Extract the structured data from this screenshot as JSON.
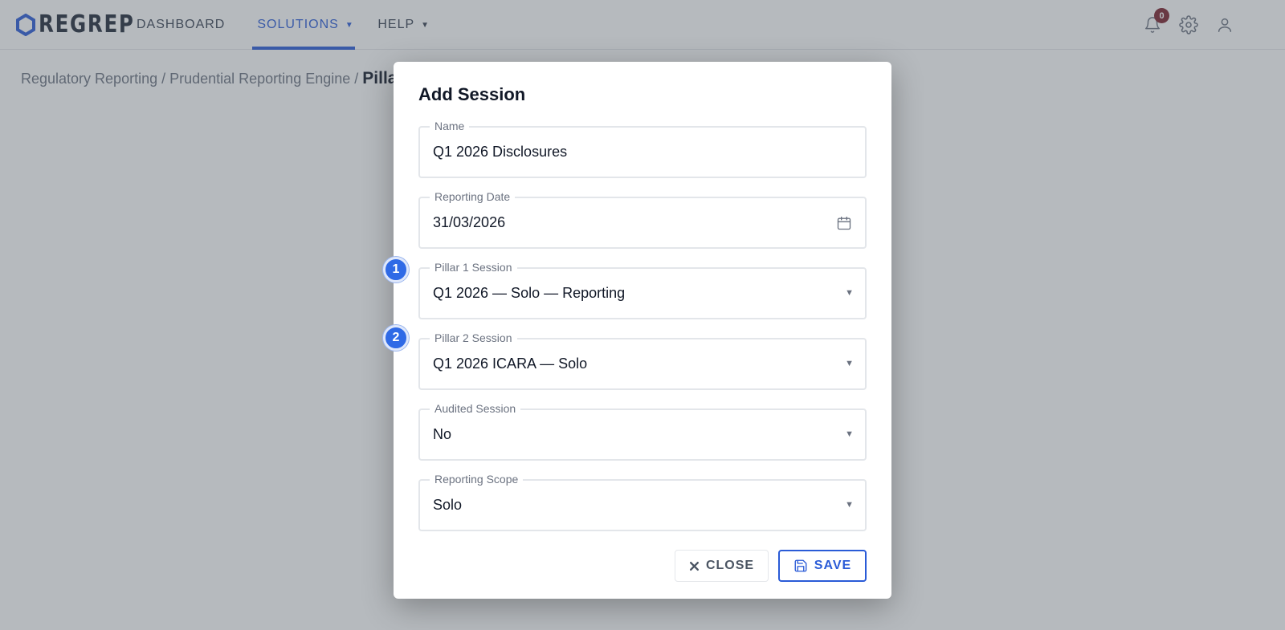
{
  "app": {
    "logo_text": "REGREP",
    "brand_color": "#2a5bd7",
    "nav": [
      {
        "label": "DASHBOARD"
      },
      {
        "label": "SOLUTIONS",
        "active": true
      },
      {
        "label": "HELP"
      }
    ],
    "notifications_count": "0"
  },
  "breadcrumb": {
    "path": "Regulatory Reporting / Prudential Reporting Engine /",
    "current": "Pillar"
  },
  "modal": {
    "title": "Add Session",
    "fields": [
      {
        "label": "Name",
        "value": "Q1 2026 Disclosures",
        "type": "text"
      },
      {
        "label": "Reporting Date",
        "value": "31/03/2026",
        "type": "date",
        "icon": "calendar-icon"
      },
      {
        "label": "Pillar 1 Session",
        "value": "Q1 2026 — Solo — Reporting",
        "type": "select",
        "step": "1"
      },
      {
        "label": "Pillar 2 Session",
        "value": "Q1 2026 ICARA — Solo",
        "type": "select",
        "step": "2"
      },
      {
        "label": "Audited Session",
        "value": "No",
        "type": "select"
      },
      {
        "label": "Reporting Scope",
        "value": "Solo",
        "type": "select"
      }
    ],
    "close_label": "CLOSE",
    "save_label": "SAVE"
  }
}
